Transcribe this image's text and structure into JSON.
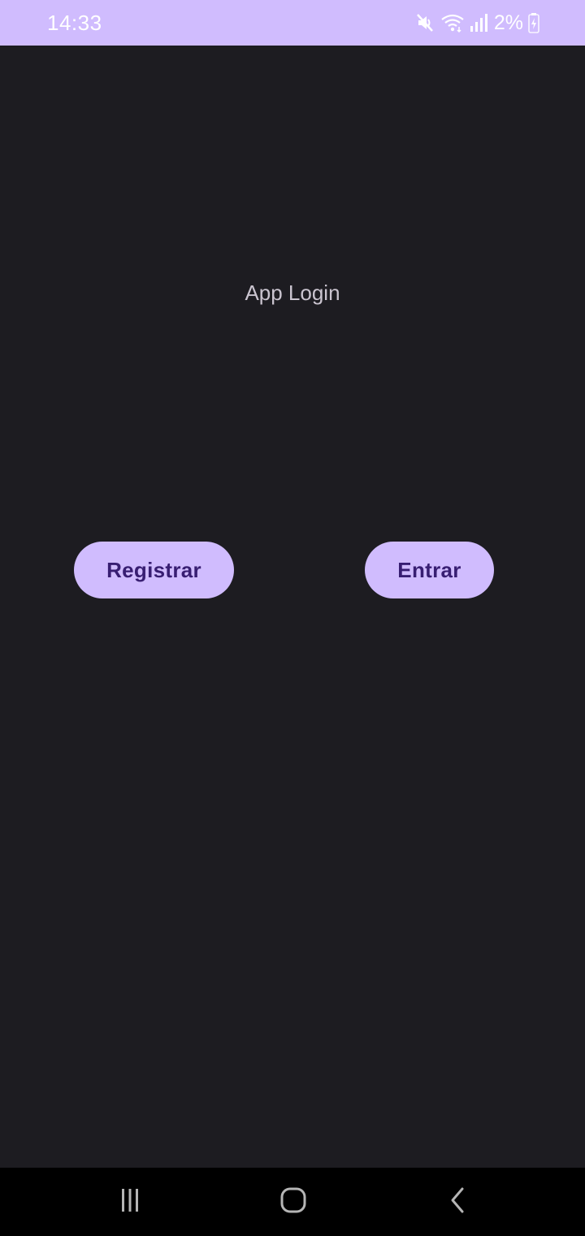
{
  "status_bar": {
    "time": "14:33",
    "battery_percent": "2%",
    "icons": [
      "mute-icon",
      "wifi-icon",
      "signal-icon",
      "battery-charging-icon"
    ]
  },
  "main": {
    "title": "App Login",
    "buttons": {
      "register_label": "Registrar",
      "enter_label": "Entrar"
    }
  },
  "nav_bar": {
    "icons": [
      "recents-icon",
      "home-icon",
      "back-icon"
    ]
  },
  "colors": {
    "accent": "#d0bcfe",
    "button_text": "#381e72",
    "background": "#1d1c21",
    "title_text": "#cac4cf",
    "nav_background": "#000000"
  }
}
